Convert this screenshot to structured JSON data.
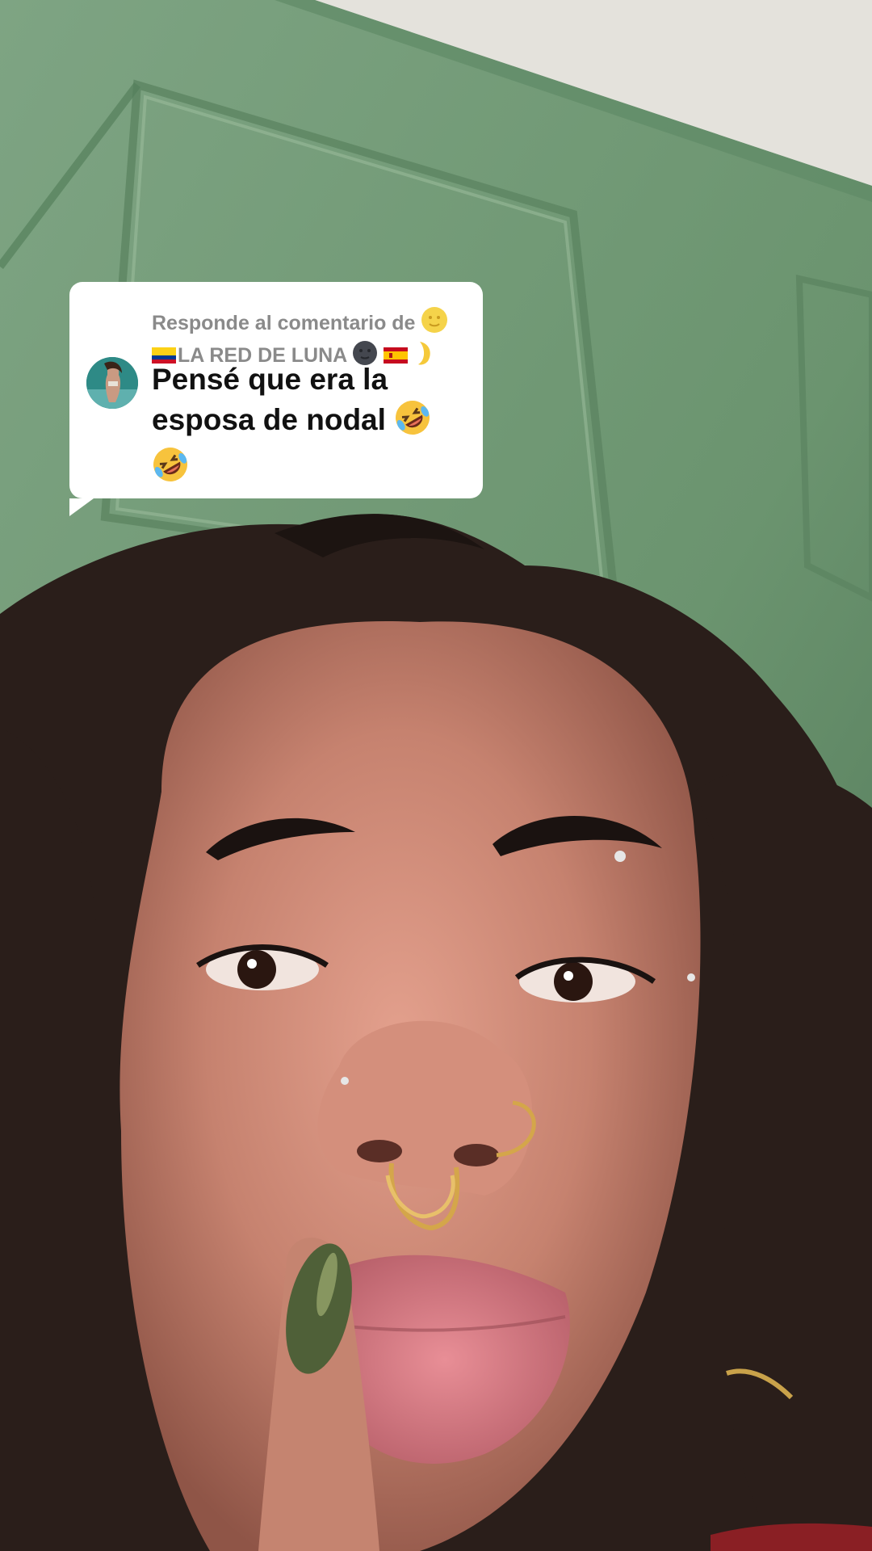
{
  "reply_sticker": {
    "header_prefix": "Responde al comentario de",
    "header_username": "LA RED DE LUNA",
    "header_emojis": [
      "full-moon-face",
      "colombia-flag",
      "new-moon-face",
      "spain-flag",
      "crescent-moon"
    ],
    "comment_text": "Pensé que era la esposa de nodal",
    "comment_emojis": [
      "rolling-on-floor-laughing",
      "rolling-on-floor-laughing"
    ]
  },
  "colors": {
    "wall_green": "#6f9a78",
    "ceiling": "#e4e2dc",
    "skin": "#c98a78",
    "hair": "#2a1e1a",
    "sticker_bg": "#ffffff",
    "header_text": "#8a8a8a",
    "comment_text": "#111111"
  }
}
